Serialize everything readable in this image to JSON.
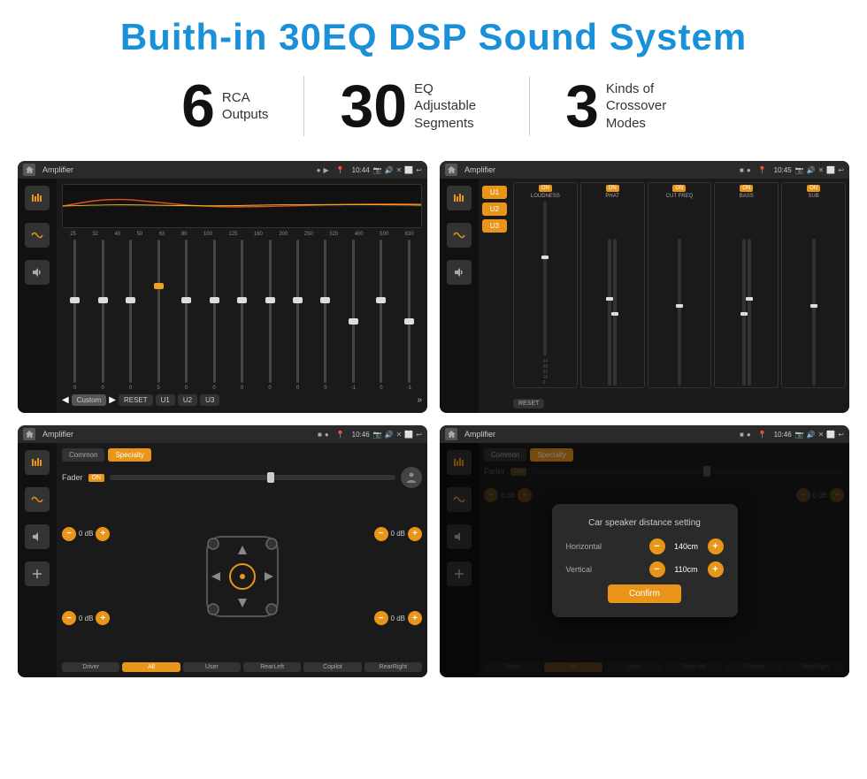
{
  "page": {
    "title": "Buith-in 30EQ DSP Sound System"
  },
  "stats": [
    {
      "number": "6",
      "label_line1": "RCA",
      "label_line2": "Outputs"
    },
    {
      "number": "30",
      "label_line1": "EQ Adjustable",
      "label_line2": "Segments"
    },
    {
      "number": "3",
      "label_line1": "Kinds of",
      "label_line2": "Crossover Modes"
    }
  ],
  "screen1": {
    "title": "Amplifier",
    "time": "10:44",
    "freq_labels": [
      "25",
      "32",
      "40",
      "50",
      "63",
      "80",
      "100",
      "125",
      "160",
      "200",
      "250",
      "320",
      "400",
      "500",
      "630"
    ],
    "slider_values": [
      "0",
      "0",
      "0",
      "5",
      "0",
      "0",
      "0",
      "0",
      "0",
      "0",
      "-1",
      "0",
      "-1"
    ],
    "footer_buttons": [
      "Custom",
      "RESET",
      "U1",
      "U2",
      "U3"
    ]
  },
  "screen2": {
    "title": "Amplifier",
    "time": "10:45",
    "u_buttons": [
      "U1",
      "U2",
      "U3"
    ],
    "channels": [
      {
        "on": true,
        "name": "LOUDNESS"
      },
      {
        "on": true,
        "name": "PHAT"
      },
      {
        "on": true,
        "name": "CUT FREQ"
      },
      {
        "on": true,
        "name": "BASS"
      },
      {
        "on": true,
        "name": "SUB"
      }
    ],
    "reset_label": "RESET"
  },
  "screen3": {
    "title": "Amplifier",
    "time": "10:46",
    "tabs": [
      "Common",
      "Specialty"
    ],
    "active_tab": "Specialty",
    "fader_label": "Fader",
    "fader_on": "ON",
    "db_values": [
      "0 dB",
      "0 dB",
      "0 dB",
      "0 dB"
    ],
    "footer_buttons": [
      "Driver",
      "All",
      "User",
      "RearLeft",
      "Copilot",
      "RearRight"
    ]
  },
  "screen4": {
    "title": "Amplifier",
    "time": "10:46",
    "tabs": [
      "Common",
      "Specialty"
    ],
    "active_tab": "Specialty",
    "dialog": {
      "title": "Car speaker distance setting",
      "horizontal_label": "Horizontal",
      "horizontal_value": "140cm",
      "vertical_label": "Vertical",
      "vertical_value": "110cm",
      "confirm_label": "Confirm"
    },
    "footer_buttons": [
      "Driver",
      "All",
      "User",
      "RearLeft",
      "Copilot",
      "RearRight"
    ]
  }
}
